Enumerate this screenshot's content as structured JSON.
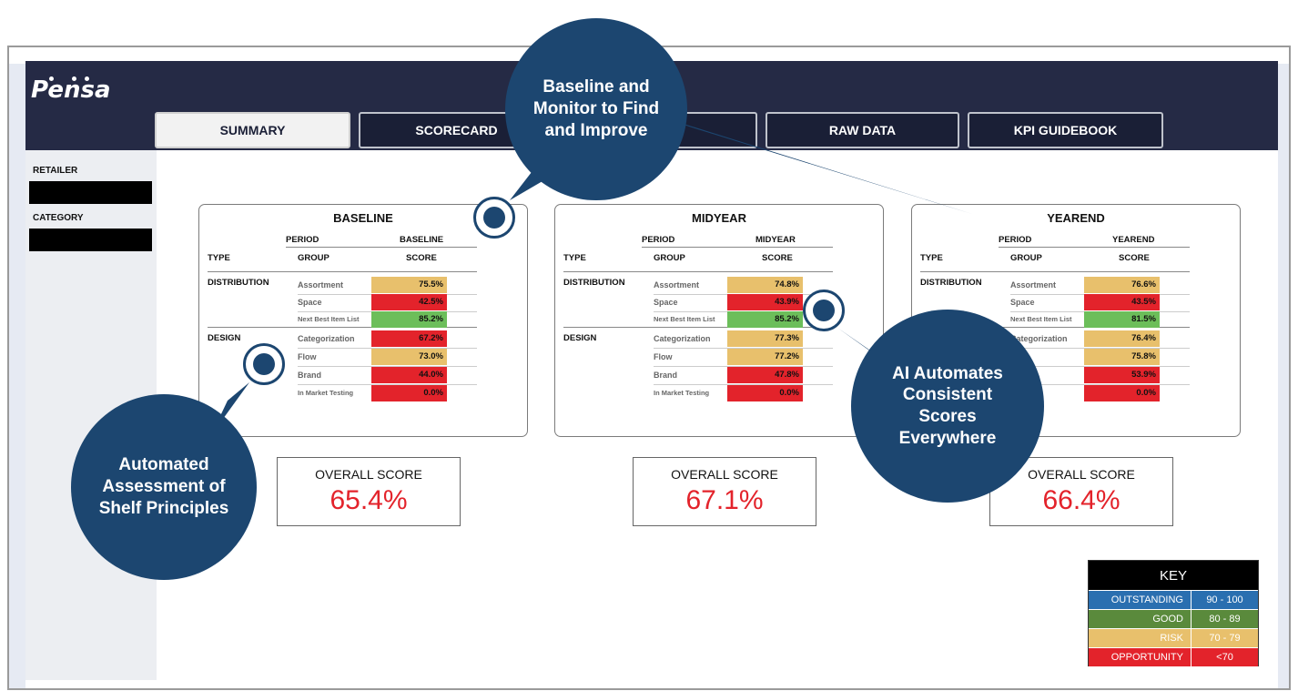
{
  "app": {
    "logo": "Pensa"
  },
  "tabs": [
    {
      "label": "SUMMARY"
    },
    {
      "label": "SCORECARD"
    },
    {
      "label": ""
    },
    {
      "label": "RAW DATA"
    },
    {
      "label": "KPI GUIDEBOOK"
    }
  ],
  "sidebar": {
    "retailer_label": "RETAILER",
    "category_label": "CATEGORY"
  },
  "colors": {
    "risk": "#e8c06c",
    "opportunity": "#e3232b",
    "good": "#6cbe5a",
    "outstanding": "#2a6fb0",
    "key_good": "#5a8a3c",
    "header": "#252a45",
    "callout": "#1c4670"
  },
  "table_headers": {
    "period": "PERIOD",
    "type": "TYPE",
    "group": "GROUP",
    "score": "SCORE"
  },
  "cards": [
    {
      "title": "BASELINE",
      "period_value": "BASELINE",
      "types": [
        "DISTRIBUTION",
        "DESIGN"
      ],
      "rows": [
        {
          "group": "Assortment",
          "score": "75.5%",
          "level": "risk"
        },
        {
          "group": "Space",
          "score": "42.5%",
          "level": "opportunity"
        },
        {
          "group": "Next Best Item List",
          "score": "85.2%",
          "level": "good"
        },
        {
          "group": "Categorization",
          "score": "67.2%",
          "level": "opportunity"
        },
        {
          "group": "Flow",
          "score": "73.0%",
          "level": "risk"
        },
        {
          "group": "Brand",
          "score": "44.0%",
          "level": "opportunity"
        },
        {
          "group": "In Market Testing",
          "score": "0.0%",
          "level": "opportunity"
        }
      ],
      "overall_label": "OVERALL SCORE",
      "overall_value": "65.4%"
    },
    {
      "title": "MIDYEAR",
      "period_value": "MIDYEAR",
      "types": [
        "DISTRIBUTION",
        "DESIGN"
      ],
      "rows": [
        {
          "group": "Assortment",
          "score": "74.8%",
          "level": "risk"
        },
        {
          "group": "Space",
          "score": "43.9%",
          "level": "opportunity"
        },
        {
          "group": "Next Best Item List",
          "score": "85.2%",
          "level": "good"
        },
        {
          "group": "Categorization",
          "score": "77.3%",
          "level": "risk"
        },
        {
          "group": "Flow",
          "score": "77.2%",
          "level": "risk"
        },
        {
          "group": "Brand",
          "score": "47.8%",
          "level": "opportunity"
        },
        {
          "group": "In Market Testing",
          "score": "0.0%",
          "level": "opportunity"
        }
      ],
      "overall_label": "OVERALL SCORE",
      "overall_value": "67.1%"
    },
    {
      "title": "YEAREND",
      "period_value": "YEAREND",
      "types": [
        "DISTRIBUTION",
        ""
      ],
      "rows": [
        {
          "group": "Assortment",
          "score": "76.6%",
          "level": "risk"
        },
        {
          "group": "Space",
          "score": "43.5%",
          "level": "opportunity"
        },
        {
          "group": "Next Best Item List",
          "score": "81.5%",
          "level": "good"
        },
        {
          "group": "Categorization",
          "score": "76.4%",
          "level": "risk"
        },
        {
          "group": "",
          "score": "75.8%",
          "level": "risk"
        },
        {
          "group": "",
          "score": "53.9%",
          "level": "opportunity"
        },
        {
          "group": "Testing",
          "score": "0.0%",
          "level": "opportunity"
        }
      ],
      "overall_label": "OVERALL SCORE",
      "overall_value": "66.4%"
    }
  ],
  "key": {
    "title": "KEY",
    "rows": [
      {
        "name": "OUTSTANDING",
        "range": "90 - 100",
        "level": "outstanding"
      },
      {
        "name": "GOOD",
        "range": "80 - 89",
        "level": "key_good"
      },
      {
        "name": "RISK",
        "range": "70 - 79",
        "level": "risk"
      },
      {
        "name": "OPPORTUNITY",
        "range": "<70",
        "level": "opportunity"
      }
    ]
  },
  "callouts": {
    "baseline": "Baseline and Monitor to Find and Improve",
    "automated": "Automated Assessment of Shelf Principles",
    "ai": "AI Automates Consistent Scores Everywhere"
  }
}
